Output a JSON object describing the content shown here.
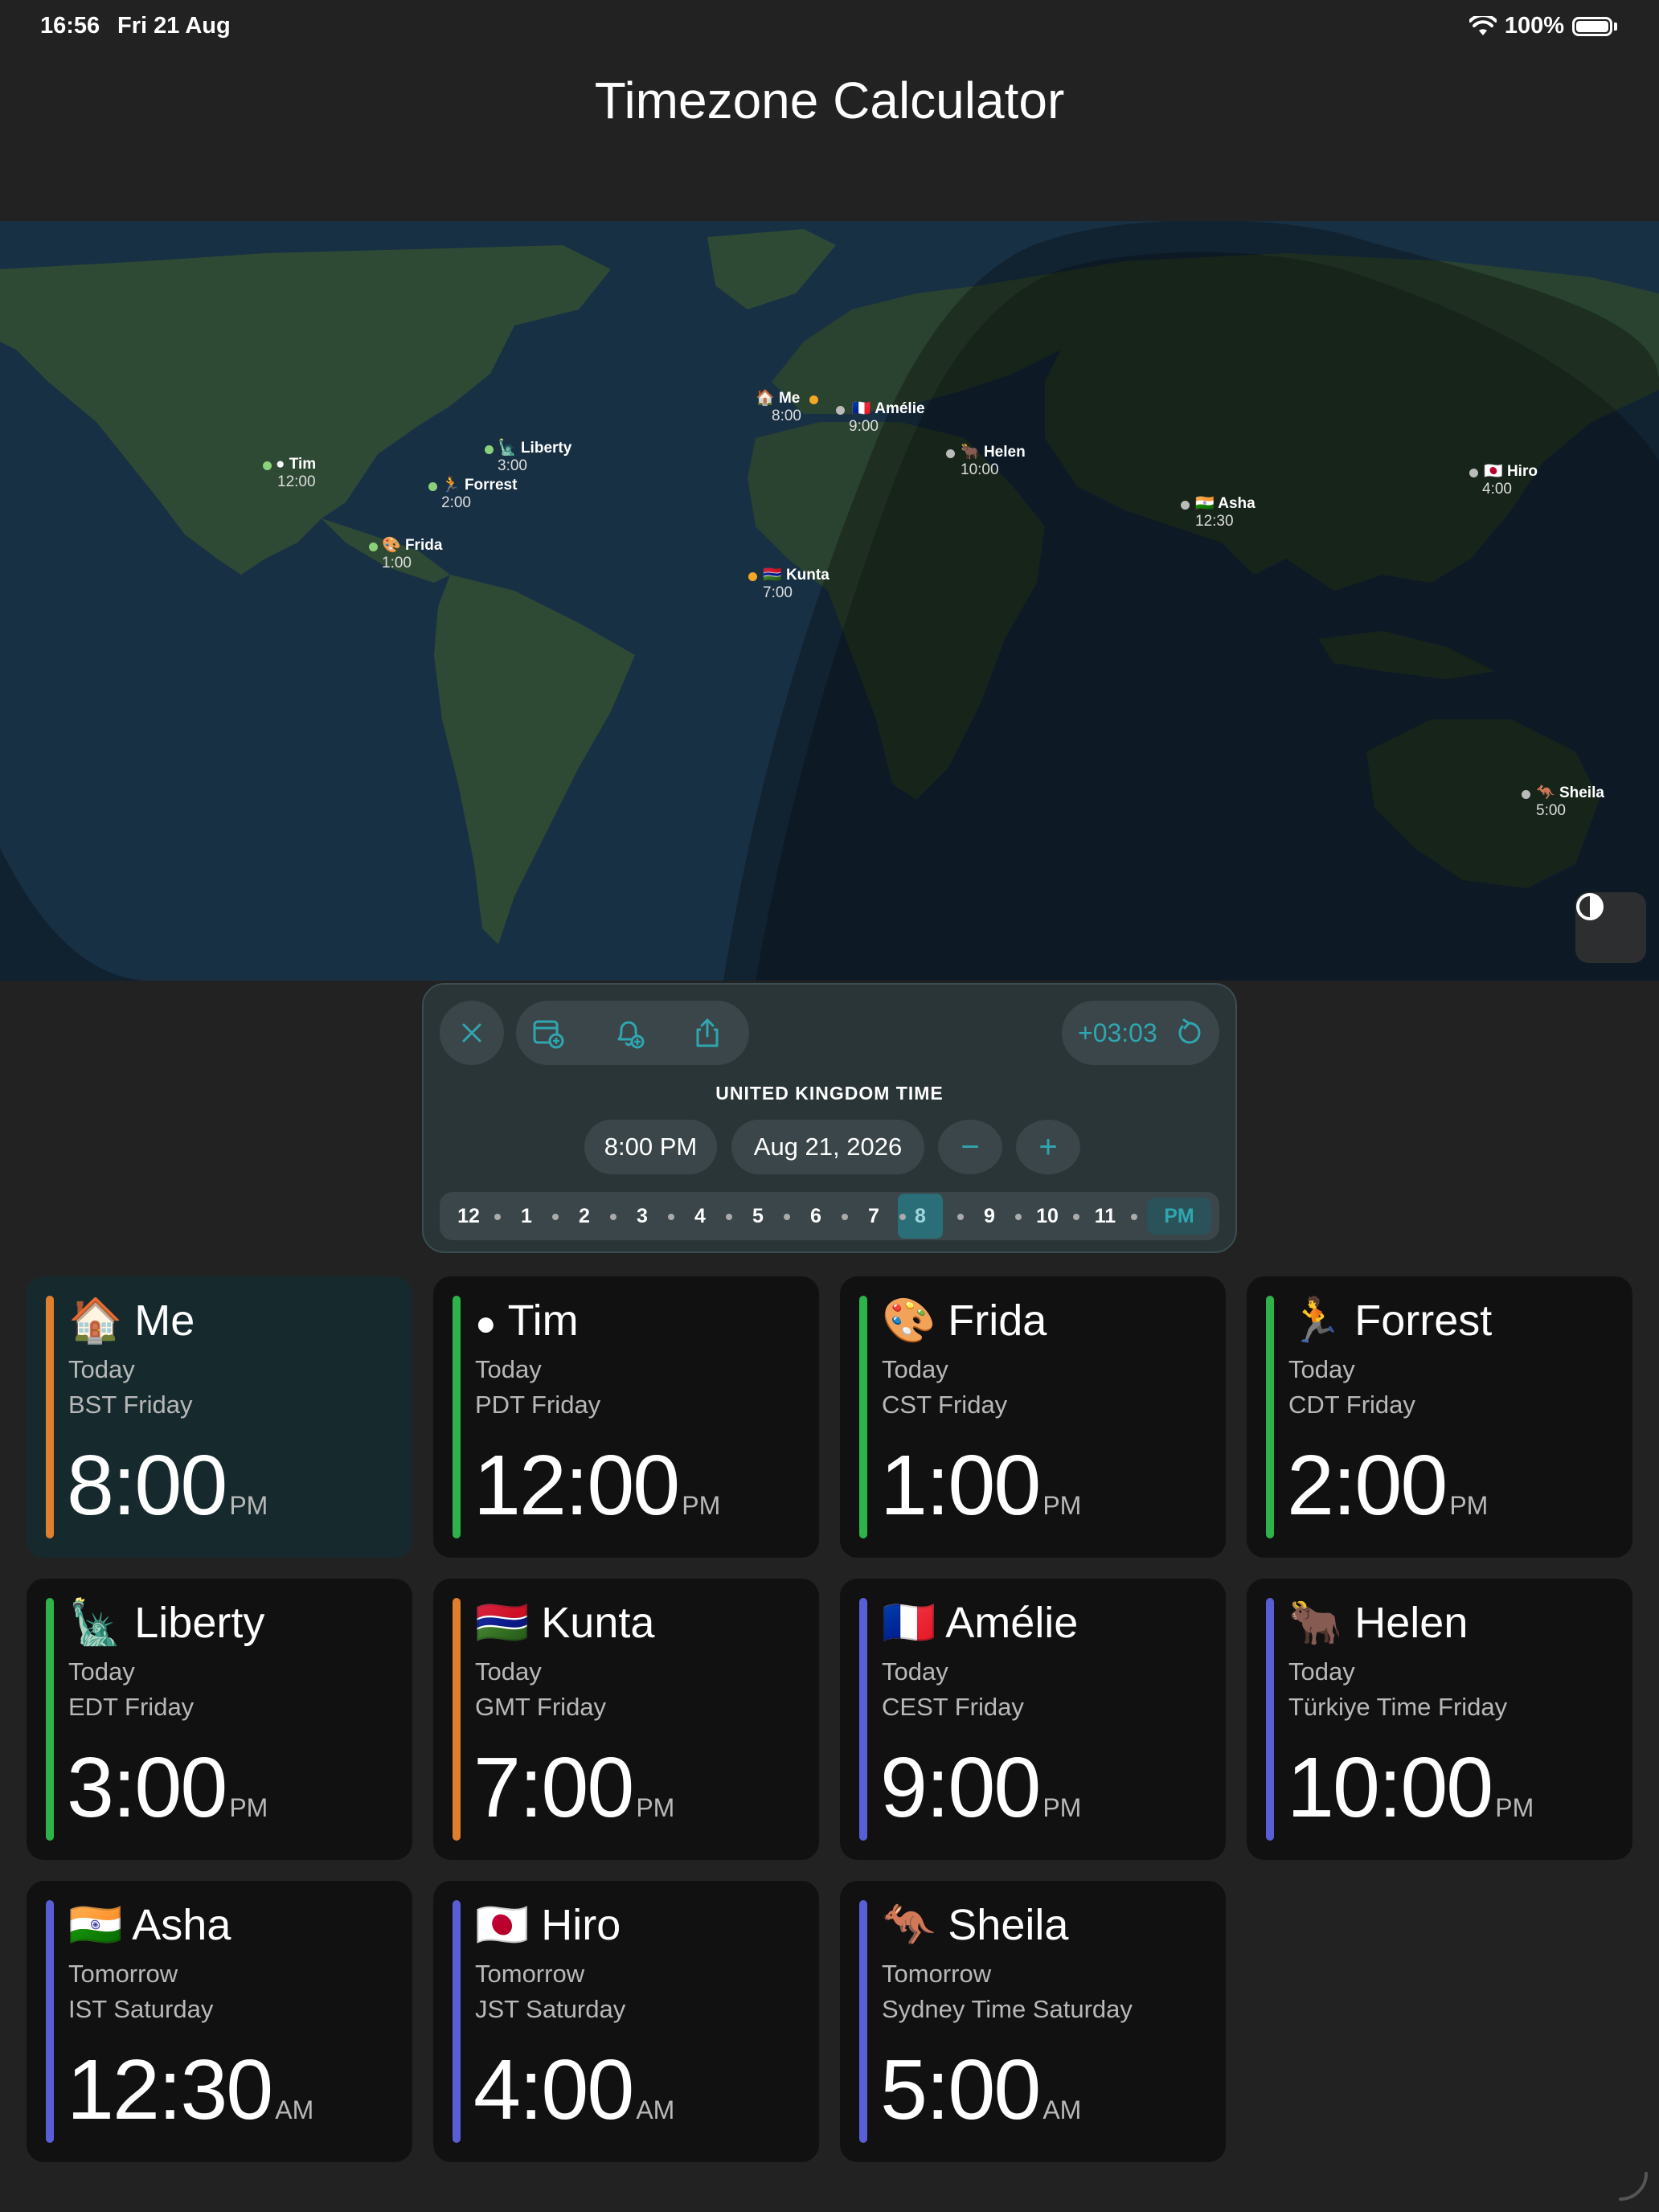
{
  "status_bar": {
    "time": "16:56",
    "date": "Fri 21 Aug",
    "battery": "100%"
  },
  "app_title": "Timezone Calculator",
  "map_pins": [
    {
      "emoji": "🏠",
      "name": "Me",
      "time": "8:00",
      "color": "#f5a623"
    },
    {
      "emoji": "🇫🇷",
      "name": "Amélie",
      "time": "9:00",
      "color": "#bbbbbb"
    },
    {
      "emoji": "🐂",
      "name": "Helen",
      "time": "10:00",
      "color": "#bbbbbb"
    },
    {
      "emoji": "",
      "name": "Tim",
      "time": "12:00",
      "color": "#8ad17a"
    },
    {
      "emoji": "🗽",
      "name": "Liberty",
      "time": "3:00",
      "color": "#8ad17a"
    },
    {
      "emoji": "🏃",
      "name": "Forrest",
      "time": "2:00",
      "color": "#8ad17a"
    },
    {
      "emoji": "🎨",
      "name": "Frida",
      "time": "1:00",
      "color": "#8ad17a"
    },
    {
      "emoji": "🇬🇲",
      "name": "Kunta",
      "time": "7:00",
      "color": "#f5a623"
    },
    {
      "emoji": "🇯🇵",
      "name": "Hiro",
      "time": "4:00",
      "color": "#bbbbbb"
    },
    {
      "emoji": "🇮🇳",
      "name": "Asha",
      "time": "12:30",
      "color": "#bbbbbb"
    },
    {
      "emoji": "🦘",
      "name": "Sheila",
      "time": "5:00",
      "color": "#bbbbbb"
    }
  ],
  "panel": {
    "offset": "+03:03",
    "zone_label": "UNITED KINGDOM TIME",
    "time_value": "8:00 PM",
    "date_value": "Aug 21, 2026",
    "minus": "−",
    "plus": "+",
    "hours": [
      "12",
      "1",
      "2",
      "3",
      "4",
      "5",
      "6",
      "7",
      "8",
      "9",
      "10",
      "11"
    ],
    "selected_hour": "8",
    "meridiem": "PM"
  },
  "cards": [
    {
      "emoji": "🏠",
      "name": "Me",
      "day": "Today",
      "zone": "BST Friday",
      "time": "8:00",
      "ampm": "PM",
      "accent": "#e07f2e"
    },
    {
      "emoji": "",
      "name": "Tim",
      "day": "Today",
      "zone": "PDT Friday",
      "time": "12:00",
      "ampm": "PM",
      "accent": "#2db34a"
    },
    {
      "emoji": "🎨",
      "name": "Frida",
      "day": "Today",
      "zone": "CST Friday",
      "time": "1:00",
      "ampm": "PM",
      "accent": "#2db34a"
    },
    {
      "emoji": "🏃",
      "name": "Forrest",
      "day": "Today",
      "zone": "CDT Friday",
      "time": "2:00",
      "ampm": "PM",
      "accent": "#2db34a"
    },
    {
      "emoji": "🗽",
      "name": "Liberty",
      "day": "Today",
      "zone": "EDT Friday",
      "time": "3:00",
      "ampm": "PM",
      "accent": "#2db34a"
    },
    {
      "emoji": "🇬🇲",
      "name": "Kunta",
      "day": "Today",
      "zone": "GMT Friday",
      "time": "7:00",
      "ampm": "PM",
      "accent": "#e07f2e"
    },
    {
      "emoji": "🇫🇷",
      "name": "Amélie",
      "day": "Today",
      "zone": "CEST Friday",
      "time": "9:00",
      "ampm": "PM",
      "accent": "#5a5ed6"
    },
    {
      "emoji": "🐂",
      "name": "Helen",
      "day": "Today",
      "zone": "Türkiye Time Friday",
      "time": "10:00",
      "ampm": "PM",
      "accent": "#5a5ed6"
    },
    {
      "emoji": "🇮🇳",
      "name": "Asha",
      "day": "Tomorrow",
      "zone": "IST Saturday",
      "time": "12:30",
      "ampm": "AM",
      "accent": "#5a5ed6"
    },
    {
      "emoji": "🇯🇵",
      "name": "Hiro",
      "day": "Tomorrow",
      "zone": "JST Saturday",
      "time": "4:00",
      "ampm": "AM",
      "accent": "#5a5ed6"
    },
    {
      "emoji": "🦘",
      "name": "Sheila",
      "day": "Tomorrow",
      "zone": "Sydney Time Saturday",
      "time": "5:00",
      "ampm": "AM",
      "accent": "#5a5ed6"
    }
  ]
}
